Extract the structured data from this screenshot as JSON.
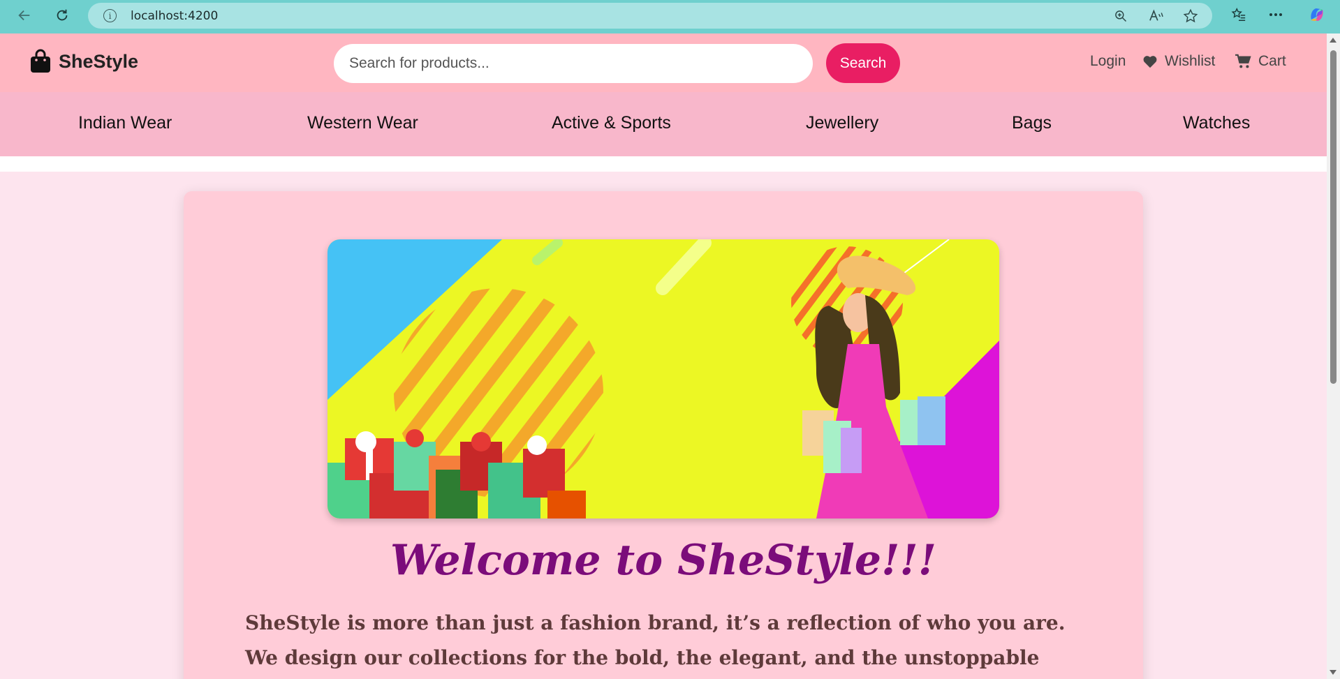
{
  "browser": {
    "url": "localhost:4200"
  },
  "header": {
    "logo_text": "SheStyle",
    "search_placeholder": "Search for products...",
    "search_button": "Search",
    "login": "Login",
    "wishlist": "Wishlist",
    "cart": "Cart"
  },
  "nav": {
    "items": [
      {
        "label": "Indian Wear"
      },
      {
        "label": "Western Wear"
      },
      {
        "label": "Active & Sports"
      },
      {
        "label": "Jewellery"
      },
      {
        "label": "Bags"
      },
      {
        "label": "Watches"
      }
    ]
  },
  "hero": {
    "welcome": "Welcome to SheStyle!!!",
    "about": "SheStyle is more than just a fashion brand, it’s a reflection of who you are. We design our collections for the bold, the elegant, and the unstoppable woman who knows that"
  },
  "colors": {
    "header_bg": "#ffb6c1",
    "nav_bg": "#f8b7cb",
    "accent": "#e91e63",
    "title": "#7b0c7a"
  }
}
